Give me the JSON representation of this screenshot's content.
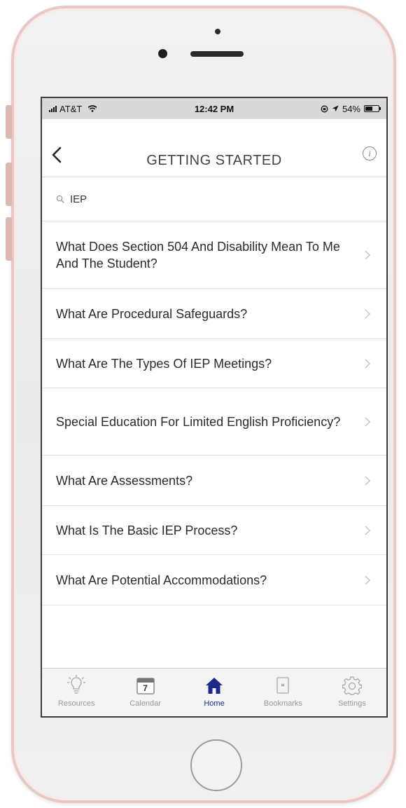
{
  "status_bar": {
    "carrier": "AT&T",
    "time": "12:42 PM",
    "battery_text": "54%",
    "battery_level": 0.54
  },
  "header": {
    "title": "GETTING STARTED"
  },
  "search": {
    "value": "IEP"
  },
  "list": {
    "items": [
      {
        "label": "What Does Section 504 And Disability Mean To Me And The Student?"
      },
      {
        "label": "What Are Procedural Safeguards?"
      },
      {
        "label": "What Are The Types Of IEP Meetings?"
      },
      {
        "label": "Special Education For Limited English Proficiency?"
      },
      {
        "label": "What Are Assessments?"
      },
      {
        "label": "What Is The Basic IEP Process?"
      },
      {
        "label": "What Are Potential Accommodations?"
      }
    ]
  },
  "tab_bar": {
    "tabs": [
      {
        "label": "Resources",
        "icon": "lightbulb-icon"
      },
      {
        "label": "Calendar",
        "icon": "calendar-icon",
        "icon_text": "7"
      },
      {
        "label": "Home",
        "icon": "home-icon",
        "active": true
      },
      {
        "label": "Bookmarks",
        "icon": "bookmark-icon"
      },
      {
        "label": "Settings",
        "icon": "gear-icon"
      }
    ]
  },
  "colors": {
    "accent": "#1b2a8c",
    "inactive": "#9a9a9a",
    "status_bar_bg": "#d9d9d9",
    "frame": "#e6c9c3"
  }
}
